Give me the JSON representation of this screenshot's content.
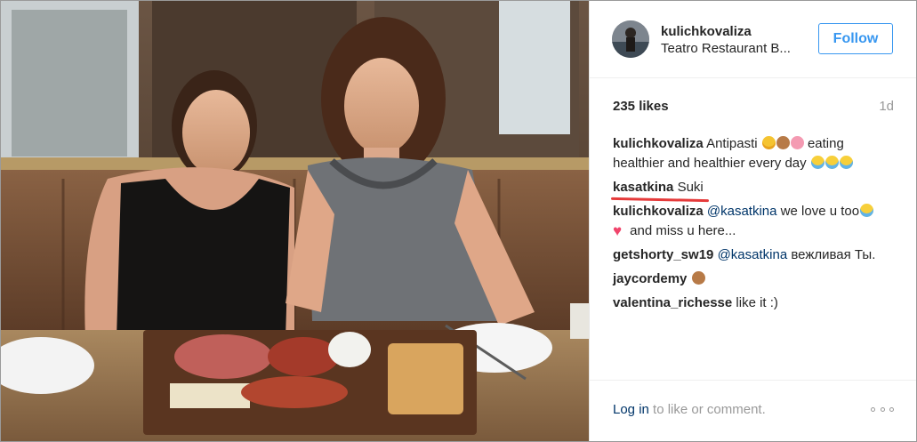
{
  "post": {
    "username": "kulichkovaliza",
    "location": "Teatro Restaurant B...",
    "follow_label": "Follow",
    "likes": "235 likes",
    "time_ago": "1d",
    "comments": [
      {
        "user": "kulichkovaliza",
        "text_before": "Antipasti",
        "emojis_1": [
          "smiling-face-heart-eyes",
          "see-no-evil-monkey",
          "pig-face"
        ],
        "text_after": "eating healthier and healthier every day",
        "emojis_2": [
          "tears-of-joy",
          "tears-of-joy",
          "tears-of-joy"
        ]
      },
      {
        "user": "kasatkina",
        "text": "Suki",
        "underlined": true
      },
      {
        "user": "kulichkovaliza",
        "mention": "@kasatkina",
        "text": "we love u too",
        "emoji_a": "tears-of-joy",
        "emoji_b": "red-heart",
        "text_after": "and miss u here..."
      },
      {
        "user": "getshorty_sw19",
        "mention": "@kasatkina",
        "text": "вежливая Ты."
      },
      {
        "user": "jaycordemy",
        "emoji": "see-no-evil-monkey"
      },
      {
        "user": "valentina_richesse",
        "text": "like it :)"
      }
    ],
    "login_link": "Log in",
    "login_rest": "to like or comment.",
    "more_icon": "more-options-icon"
  },
  "colors": {
    "link_blue": "#003569",
    "follow_blue": "#3897f0",
    "muted_gray": "#999999",
    "underline_red": "#e53a3a"
  }
}
